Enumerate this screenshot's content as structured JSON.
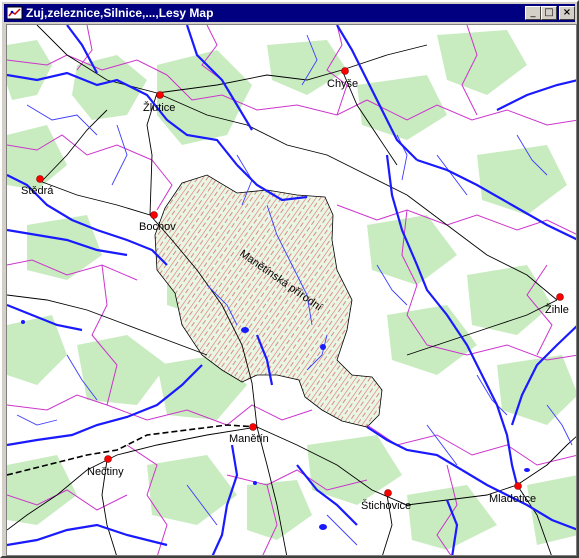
{
  "window": {
    "title": "Zuj,zeleznice,Silnice,...,Lesy Map",
    "controls": {
      "minimize": "_",
      "maximize": "□",
      "close": "×"
    }
  },
  "map": {
    "layers": [
      "Zuj",
      "zeleznice",
      "Silnice",
      "Lesy"
    ],
    "colors": {
      "forest": "#c8ecc0",
      "rivers": "#1a1aff",
      "streams": "#3c3cff",
      "boundaries": "#cc33cc",
      "roads": "#000000",
      "protected_area_hatch": "#e07070",
      "town_marker": "#ff0000"
    },
    "towns": [
      {
        "name": "Chyše"
      },
      {
        "name": "Žlutice"
      },
      {
        "name": "Stědrá"
      },
      {
        "name": "Bochov"
      },
      {
        "name": "Žihle"
      },
      {
        "name": "Manětín"
      },
      {
        "name": "Nečtiny"
      },
      {
        "name": "Štichovice"
      },
      {
        "name": "Mladotice"
      }
    ],
    "area_label": "Manětínská přírodní"
  }
}
